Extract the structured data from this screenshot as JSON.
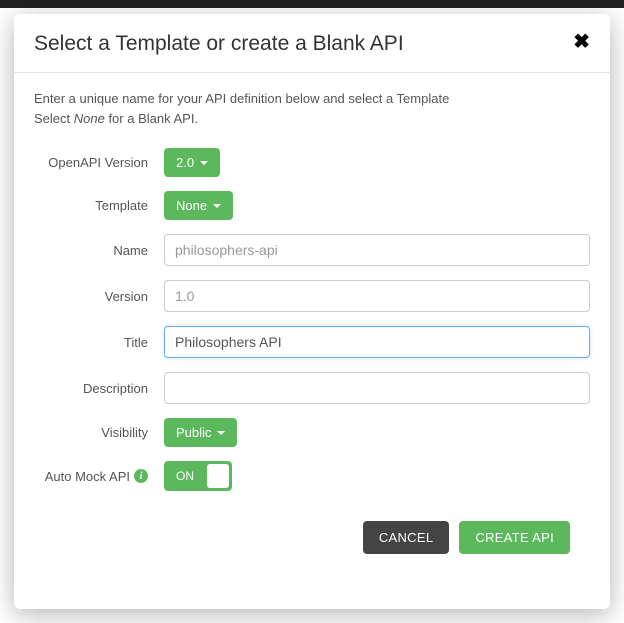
{
  "modal": {
    "title": "Select a Template or create a Blank API",
    "intro_line1": "Enter a unique name for your API definition below and select a Template",
    "intro_prefix": "Select ",
    "intro_em": "None",
    "intro_suffix": " for a Blank API."
  },
  "form": {
    "openapi_version": {
      "label": "OpenAPI Version",
      "value": "2.0"
    },
    "template": {
      "label": "Template",
      "value": "None"
    },
    "name": {
      "label": "Name",
      "placeholder": "philosophers-api",
      "value": ""
    },
    "version": {
      "label": "Version",
      "placeholder": "1.0",
      "value": ""
    },
    "title": {
      "label": "Title",
      "value": "Philosophers API"
    },
    "description": {
      "label": "Description",
      "value": ""
    },
    "visibility": {
      "label": "Visibility",
      "value": "Public"
    },
    "auto_mock": {
      "label": "Auto Mock API",
      "value": "ON"
    }
  },
  "buttons": {
    "cancel": "CANCEL",
    "create": "CREATE API"
  }
}
